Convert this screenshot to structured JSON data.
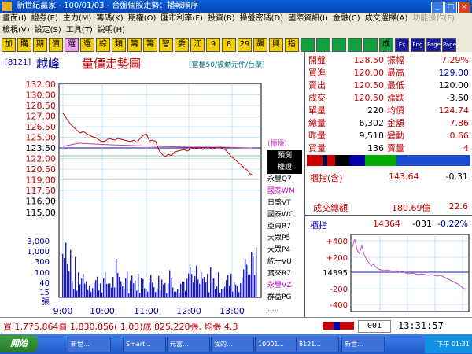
{
  "window": {
    "title": "新世紀贏家 - 100/01/03 - 台盤個股走勢：播報順序"
  },
  "menu_row1": [
    "畫面(I)",
    "證券(E)",
    "主力(M)",
    "籌碼(K)",
    "期權(O)",
    "匯市利率(F)",
    "投資(B)",
    "操盤密碼(D)",
    "國際資訊(I)",
    "金融(C)",
    "成交選擇(A)",
    "功能操作(F)"
  ],
  "menu_row2": [
    "檢視(V)",
    "設定(S)",
    "工具(T)",
    "說明(H)"
  ],
  "toolbar": [
    "加",
    "購",
    "期",
    "價",
    "選",
    "選",
    "綜",
    "類",
    "籌",
    "籌",
    "智",
    "委",
    "江",
    "9",
    "8",
    "29",
    "飆",
    "興",
    "指",
    "",
    "",
    "",
    "",
    "",
    "成",
    "Ex",
    "Fng",
    "Page",
    "Page"
  ],
  "chart_header": {
    "code": "[8121]",
    "name": "越峰",
    "view_title": "量價走勢圖",
    "meta": "[富櫃50/被動元件/台聚]"
  },
  "price_axis": [
    "132.00",
    "130.00",
    "128.50",
    "127.00",
    "126.50",
    "125.00",
    "123.50",
    "122.00",
    "120.50",
    "119.00",
    "117.50",
    "116.00",
    "115.00"
  ],
  "volume_axis": [
    "3,000",
    "1,000",
    "300",
    "100",
    "40",
    "15",
    "張"
  ],
  "time_axis": [
    "9:00",
    "10:00",
    "11:00",
    "12:00",
    "13:00"
  ],
  "legend": {
    "header": "(櫃檯)",
    "items": [
      "預測",
      "權證",
      "永豐Q7",
      "國泰WM",
      "日盛VT",
      "國泰WC",
      "亞東R7",
      "大眾P5",
      "大眾P4",
      "統一VU",
      "寶來R7",
      "永豐VZ",
      "群益PG",
      "....."
    ]
  },
  "quote": {
    "rows": [
      {
        "l": "開盤",
        "v": "128.50",
        "l2": "振幅",
        "v2": "7.29%"
      },
      {
        "l": "買進",
        "v": "120.00",
        "l2": "最高",
        "v2": "129.00"
      },
      {
        "l": "賣出",
        "v": "120.50",
        "l2": "最低",
        "v2": "120.00"
      },
      {
        "l": "成交",
        "v": "120.50",
        "l2": "漲跌",
        "v2": "-3.50"
      },
      {
        "l": "單量",
        "v": "220",
        "l2": "均價",
        "v2": "124.74"
      },
      {
        "l": "總量",
        "v": "6,302",
        "l2": "金額",
        "v2": "7.86"
      },
      {
        "l": "昨量",
        "v": "9,518",
        "l2": "變動",
        "v2": "0.66"
      },
      {
        "l": "買量",
        "v": "136",
        "l2": "賣量",
        "v2": "4"
      }
    ]
  },
  "index": {
    "label": "櫃指(含)",
    "value": "143.64",
    "change": "-0.31",
    "total_label": "成交總額",
    "total_value": "180.69億",
    "total_change": "22.6",
    "mini_label": "櫃指",
    "mini_value": "14364",
    "mini_change": "-031",
    "mini_pct": "-0.22%",
    "mini_axis": [
      "+400",
      "+200",
      "14395",
      "-200",
      "-400"
    ]
  },
  "bottom": {
    "stat": "買 1,775,864賣 1,830,856( 1.03)成 825,220張, 均張 4.3",
    "code": "001",
    "clock": "13:31:57"
  },
  "taskbar": {
    "start": "開始",
    "tasks": [
      "新世...",
      "Smart...",
      "元富...",
      "我的...",
      "10001...",
      "8121...",
      "新世..."
    ],
    "tray_time": "下午 01:31"
  },
  "colors": {
    "price_up": "#cc0000",
    "avg_line": "#c04090",
    "ref_line": "#0000aa",
    "volume": "#1a1ad0",
    "index_line": "#c050c0",
    "index_ref": "#1a1ad0"
  }
}
